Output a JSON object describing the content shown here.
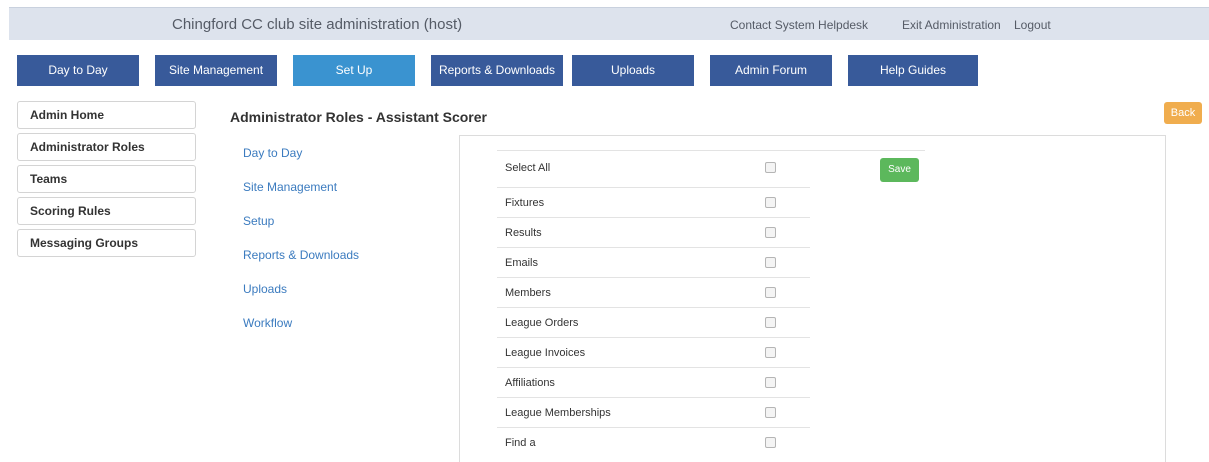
{
  "header": {
    "site_title": "Chingford CC club site administration (host)",
    "links": [
      "Contact System Helpdesk",
      "Exit Administration",
      "Logout"
    ]
  },
  "nav": [
    "Day to Day",
    "Site Management",
    "Set Up",
    "Reports & Downloads",
    "Uploads",
    "Admin Forum",
    "Help Guides"
  ],
  "nav_active": "Set Up",
  "sidebar": [
    "Admin Home",
    "Administrator Roles",
    "Teams",
    "Scoring Rules",
    "Messaging Groups"
  ],
  "page_title": "Administrator Roles - Assistant Scorer",
  "back_label": "Back",
  "sections": [
    "Day to Day",
    "Site Management",
    "Setup",
    "Reports & Downloads",
    "Uploads",
    "Workflow"
  ],
  "select_all_label": "Select All",
  "save_label": "Save",
  "permissions": [
    "Fixtures",
    "Results",
    "Emails",
    "Members",
    "League Orders",
    "League Invoices",
    "Affiliations",
    "League Memberships",
    "Find a"
  ],
  "colors": {
    "nav": "#385a9a",
    "nav_active": "#3a93d0",
    "link": "#3b7bbf",
    "save": "#5cb85c",
    "back": "#f0ad4e"
  }
}
